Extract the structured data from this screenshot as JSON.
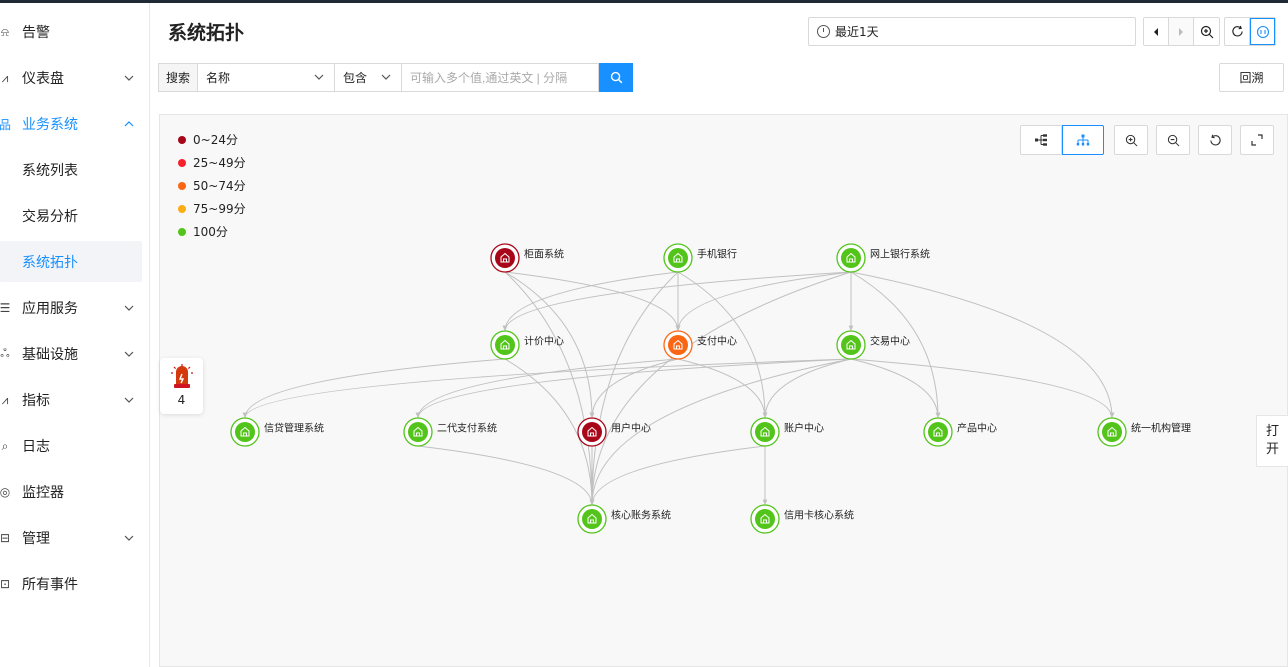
{
  "sidebar": {
    "items": [
      {
        "label": "告警",
        "icon": "alarm-bell-icon",
        "chevron": ""
      },
      {
        "label": "仪表盘",
        "icon": "dashboard-chart-icon",
        "chevron": "down"
      },
      {
        "label": "业务系统",
        "icon": "business-system-icon",
        "chevron": "up"
      },
      {
        "label": "系统列表",
        "icon": "",
        "chevron": ""
      },
      {
        "label": "交易分析",
        "icon": "",
        "chevron": ""
      },
      {
        "label": "系统拓扑",
        "icon": "",
        "chevron": ""
      },
      {
        "label": "应用服务",
        "icon": "app-service-icon",
        "chevron": "down"
      },
      {
        "label": "基础设施",
        "icon": "infrastructure-icon",
        "chevron": "down"
      },
      {
        "label": "指标",
        "icon": "metrics-icon",
        "chevron": "down"
      },
      {
        "label": "日志",
        "icon": "log-icon",
        "chevron": ""
      },
      {
        "label": "监控器",
        "icon": "monitor-icon",
        "chevron": ""
      },
      {
        "label": "管理",
        "icon": "manage-icon",
        "chevron": "down"
      },
      {
        "label": "所有事件",
        "icon": "events-icon",
        "chevron": ""
      }
    ]
  },
  "header": {
    "title": "系统拓扑",
    "time_range": "最近1天"
  },
  "search": {
    "label": "搜索",
    "field": "名称",
    "operator": "包含",
    "placeholder": "可输入多个值,通过英文 | 分隔",
    "value": ""
  },
  "back_button": "回溯",
  "legend": [
    {
      "label": "0~24分",
      "color": "#a8071a"
    },
    {
      "label": "25~49分",
      "color": "#f5222d"
    },
    {
      "label": "50~74分",
      "color": "#fa6614"
    },
    {
      "label": "75~99分",
      "color": "#faad14"
    },
    {
      "label": "100分",
      "color": "#52c41a"
    }
  ],
  "alarm": {
    "count": "4"
  },
  "open_tab": {
    "line1": "打",
    "line2": "开"
  },
  "topology": {
    "colors": {
      "green": "#52c41a",
      "darkred": "#a8071a",
      "orange": "#fa6614"
    },
    "nodes": [
      {
        "id": "guimian",
        "label": "柜面系统",
        "status": "darkred"
      },
      {
        "id": "shouji",
        "label": "手机银行",
        "status": "green"
      },
      {
        "id": "wangshang",
        "label": "网上银行系统",
        "status": "green"
      },
      {
        "id": "jijia",
        "label": "计价中心",
        "status": "green"
      },
      {
        "id": "zhifu",
        "label": "支付中心",
        "status": "orange"
      },
      {
        "id": "jiaoyi",
        "label": "交易中心",
        "status": "green"
      },
      {
        "id": "xindai",
        "label": "信贷管理系统",
        "status": "green"
      },
      {
        "id": "erdai",
        "label": "二代支付系统",
        "status": "green"
      },
      {
        "id": "yonghu",
        "label": "用户中心",
        "status": "darkred"
      },
      {
        "id": "zhanghu",
        "label": "账户中心",
        "status": "green"
      },
      {
        "id": "chanpin",
        "label": "产品中心",
        "status": "green"
      },
      {
        "id": "tongyi",
        "label": "统一机构管理",
        "status": "green"
      },
      {
        "id": "hexin",
        "label": "核心账务系统",
        "status": "green"
      },
      {
        "id": "xinyongka",
        "label": "信用卡核心系统",
        "status": "green"
      }
    ],
    "edges": [
      [
        "guimian",
        "zhifu"
      ],
      [
        "guimian",
        "yonghu"
      ],
      [
        "guimian",
        "hexin"
      ],
      [
        "shouji",
        "jijia"
      ],
      [
        "shouji",
        "zhifu"
      ],
      [
        "shouji",
        "zhanghu"
      ],
      [
        "shouji",
        "hexin"
      ],
      [
        "wangshang",
        "jijia"
      ],
      [
        "wangshang",
        "zhifu"
      ],
      [
        "wangshang",
        "jiaoyi"
      ],
      [
        "wangshang",
        "chanpin"
      ],
      [
        "wangshang",
        "tongyi"
      ],
      [
        "wangshang",
        "hexin"
      ],
      [
        "jijia",
        "xindai"
      ],
      [
        "jijia",
        "hexin"
      ],
      [
        "zhifu",
        "erdai"
      ],
      [
        "zhifu",
        "yonghu"
      ],
      [
        "zhifu",
        "zhanghu"
      ],
      [
        "jiaoyi",
        "xindai"
      ],
      [
        "jiaoyi",
        "erdai"
      ],
      [
        "jiaoyi",
        "zhanghu"
      ],
      [
        "jiaoyi",
        "chanpin"
      ],
      [
        "jiaoyi",
        "tongyi"
      ],
      [
        "jiaoyi",
        "hexin"
      ],
      [
        "erdai",
        "hexin"
      ],
      [
        "yonghu",
        "hexin"
      ],
      [
        "zhanghu",
        "hexin"
      ],
      [
        "zhanghu",
        "xinyongka"
      ]
    ]
  }
}
